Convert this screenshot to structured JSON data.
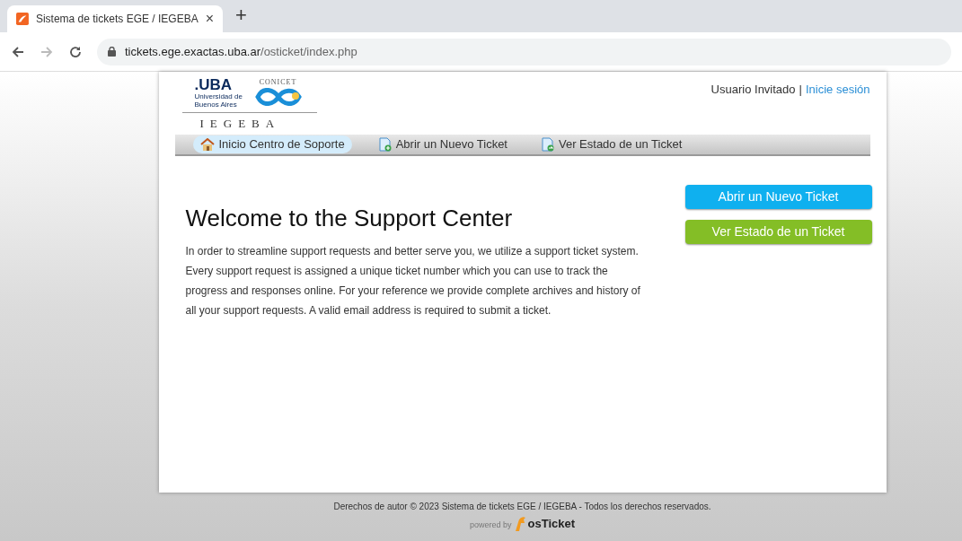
{
  "browser": {
    "tab_title": "Sistema de tickets EGE / IEGEBA",
    "tab_close": "×",
    "new_tab": "+",
    "url_host": "tickets.ege.exactas.uba.ar",
    "url_path": "/osticket/index.php"
  },
  "logo": {
    "uba": ".UBA",
    "uba_sub": "Universidad de Buenos Aires",
    "conicet": "CONICET",
    "institute": "IEGEBA"
  },
  "user_bar": {
    "user": "Usuario Invitado",
    "separator": "|",
    "login": "Inicie sesión"
  },
  "nav": [
    {
      "label": "Inicio Centro de Soporte",
      "kind": "home",
      "selected": true
    },
    {
      "label": "Abrir un Nuevo Ticket",
      "kind": "new",
      "selected": false
    },
    {
      "label": "Ver Estado de un Ticket",
      "kind": "status",
      "selected": false
    }
  ],
  "welcome": {
    "title": "Welcome to the Support Center",
    "body": "In order to streamline support requests and better serve you, we utilize a support ticket system. Every support request is assigned a unique ticket number which you can use to track the progress and responses online. For your reference we provide complete archives and history of all your support requests. A valid email address is required to submit a ticket."
  },
  "actions": [
    {
      "label": "Abrir un Nuevo Ticket",
      "kind": "blue"
    },
    {
      "label": "Ver Estado de un Ticket",
      "kind": "green"
    }
  ],
  "footer": {
    "copyright": "Derechos de autor © 2023 Sistema de tickets EGE / IEGEBA - Todos los derechos reservados.",
    "powered_by": "powered by",
    "brand": "osTicket"
  }
}
